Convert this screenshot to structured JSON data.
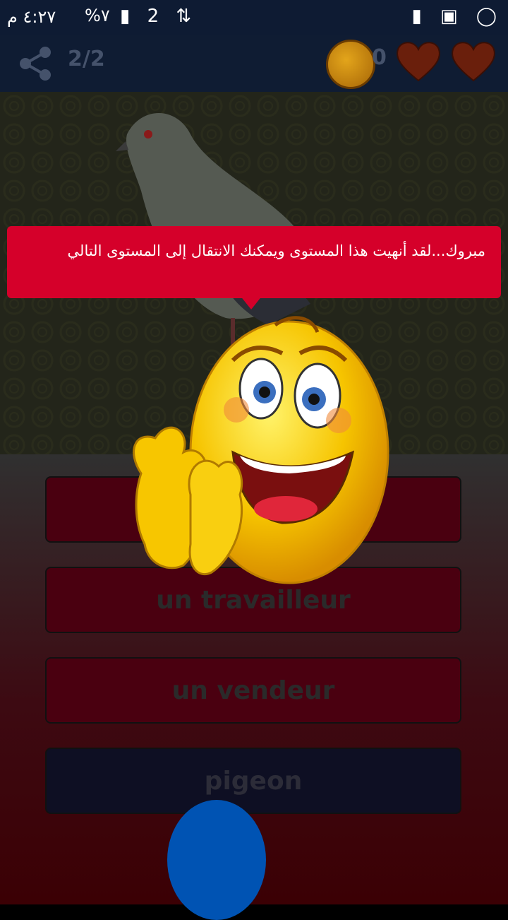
{
  "status_bar": {
    "time": "٤:٢٧ م",
    "battery": "%٧",
    "network_icons": "▮ 2 ⇅",
    "right_icons": [
      "shopping-bag-icon",
      "image-icon",
      "whatsapp-icon"
    ]
  },
  "top_bar": {
    "level": "2/2",
    "coins": "0",
    "hearts": 2
  },
  "toast": {
    "message": "مبروك...لقد أنهيت هذا المستوى ويمكنك الانتقال إلى المستوى التالي"
  },
  "answers": [
    {
      "label": "un"
    },
    {
      "label": "un travailleur"
    },
    {
      "label": "un vendeur"
    },
    {
      "label": "pigeon"
    }
  ],
  "colors": {
    "toast": "#d5002a",
    "answer_bg": "#4a0010",
    "correct_bg": "#0e0f23",
    "topbar": "#0f1c33"
  }
}
